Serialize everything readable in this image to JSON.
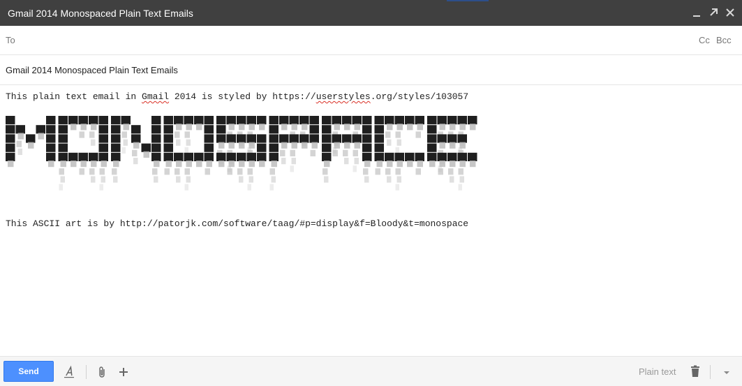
{
  "window": {
    "title": "Gmail 2014 Monospaced Plain Text Emails",
    "controls": [
      "minimize-icon",
      "popout-icon",
      "close-icon"
    ]
  },
  "recipients": {
    "to_label": "To",
    "to_value": "",
    "cc_label": "Cc",
    "bcc_label": "Bcc"
  },
  "subject": {
    "value": "Gmail 2014 Monospaced Plain Text Emails"
  },
  "body": {
    "line1_prefix": "This plain text email in ",
    "line1_gmail": "Gmail",
    "line1_middle": " 2014 is styled by ",
    "line1_https": "https",
    "line1_sep": "://",
    "line1_userstyles": "userstyles",
    "line1_suffix": ".org/styles/103057",
    "ascii_art_word": "MONOSPACE",
    "line3": "This ASCII art is by http://patorjk.com/software/taag/#p=display&f=Bloody&t=monospace"
  },
  "toolbar": {
    "send_label": "Send",
    "plain_text_label": "Plain text",
    "icons": [
      "formatting-icon",
      "paperclip-icon",
      "plus-icon",
      "trash-icon",
      "chevron-down-icon"
    ]
  },
  "colors": {
    "titlebar": "#404040",
    "send_button": "#4d90fe",
    "ascii_dark": "#1f1f1f",
    "ascii_drip": "#bbbbbb",
    "spellcheck": "#d93025"
  }
}
